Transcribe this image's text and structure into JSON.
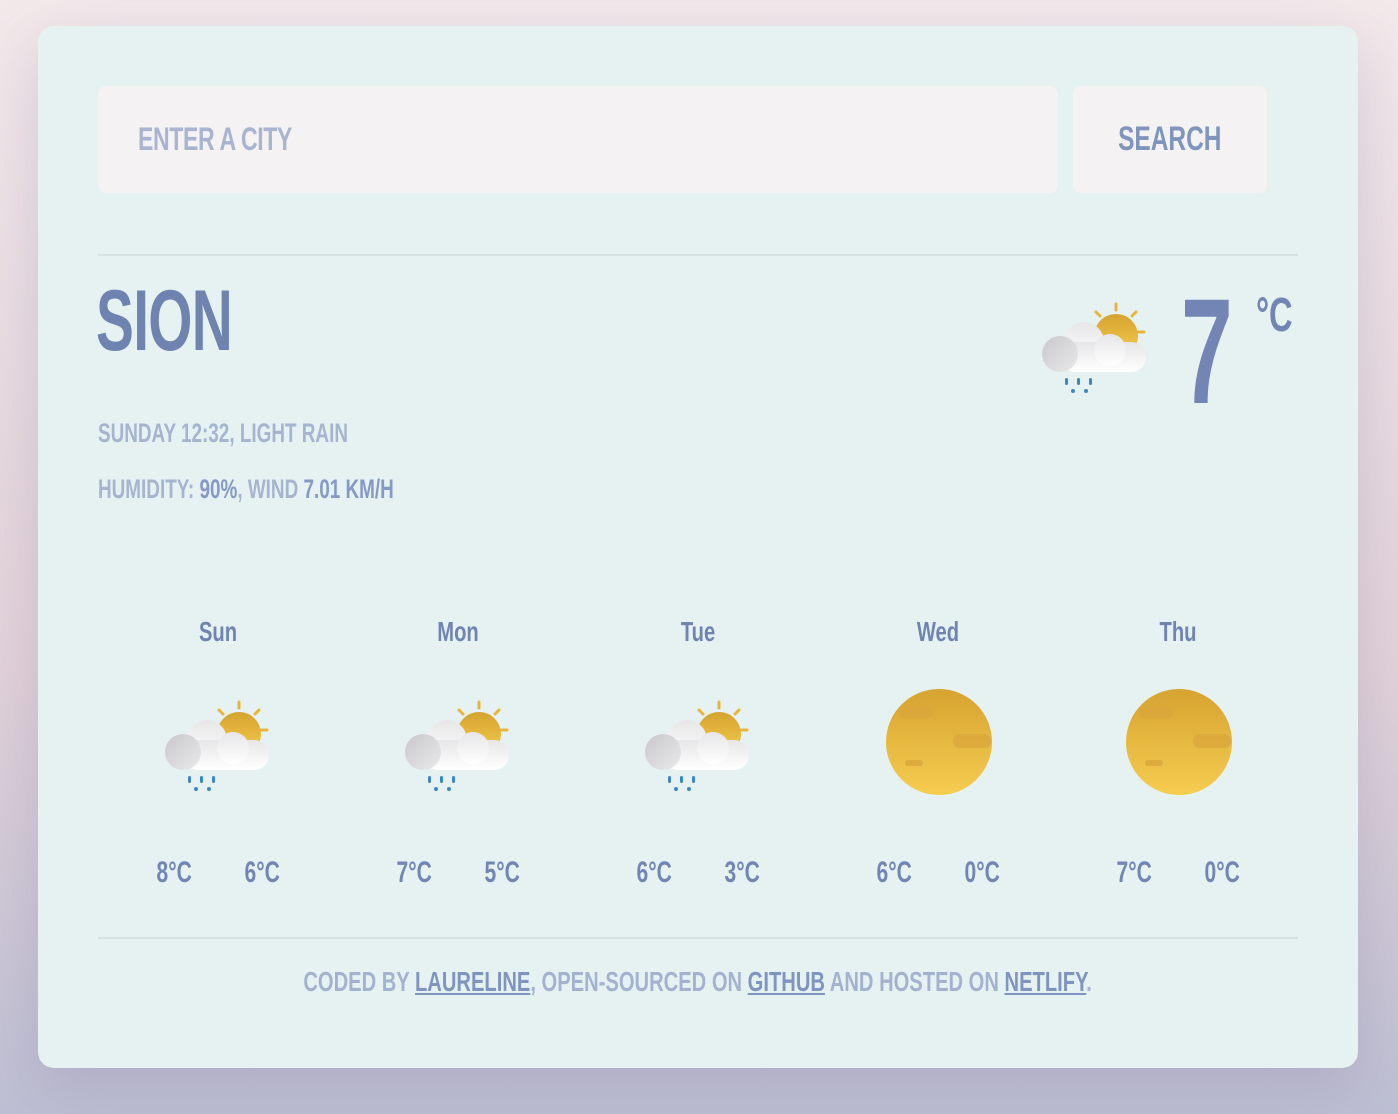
{
  "search": {
    "placeholder": "Enter a city",
    "button_label": "Search"
  },
  "current": {
    "city": "Sion",
    "datetime_condition": "Sunday 12:32, light rain",
    "humidity_label": "Humidity: ",
    "humidity_value": "90%",
    "wind_label": ", Wind ",
    "wind_value": "7.01 km/h",
    "temperature": "7",
    "unit": "°C",
    "icon": "rain-partly-cloudy-icon"
  },
  "forecast": [
    {
      "day": "Sun",
      "icon": "rain-partly-cloudy-icon",
      "max": "8°C",
      "min": "6°C"
    },
    {
      "day": "Mon",
      "icon": "rain-partly-cloudy-icon",
      "max": "7°C",
      "min": "5°C"
    },
    {
      "day": "Tue",
      "icon": "rain-partly-cloudy-icon",
      "max": "6°C",
      "min": "3°C"
    },
    {
      "day": "Wed",
      "icon": "clear-sun-icon",
      "max": "6°C",
      "min": "0°C"
    },
    {
      "day": "Thu",
      "icon": "clear-sun-icon",
      "max": "7°C",
      "min": "0°C"
    }
  ],
  "footer": {
    "coded_by": "Coded by ",
    "author_link": "Laureline",
    "open_sourced": ", open-sourced on ",
    "github_link": "GitHub",
    "hosted": " and hosted on ",
    "netlify_link": "Netlify",
    "end": "."
  },
  "colors": {
    "card_background": "#e6f2f2",
    "accent": "#7285b4",
    "muted": "#a6b4cf"
  }
}
